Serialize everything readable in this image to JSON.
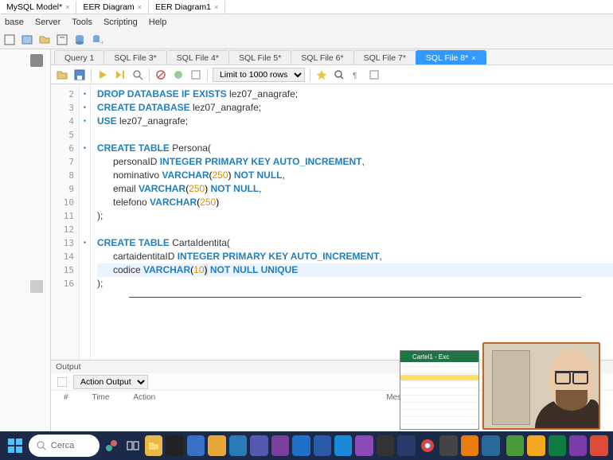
{
  "topTabs": [
    {
      "label": "MySQL Model*",
      "closable": true
    },
    {
      "label": "EER Diagram",
      "closable": true
    },
    {
      "label": "EER Diagram1",
      "closable": true
    }
  ],
  "menu": [
    "base",
    "Server",
    "Tools",
    "Scripting",
    "Help"
  ],
  "fileTabs": [
    {
      "label": "Query 1",
      "active": false
    },
    {
      "label": "SQL File 3*",
      "active": false
    },
    {
      "label": "SQL File 4*",
      "active": false
    },
    {
      "label": "SQL File 5*",
      "active": false
    },
    {
      "label": "SQL File 6*",
      "active": false
    },
    {
      "label": "SQL File 7*",
      "active": false
    },
    {
      "label": "SQL File 8*",
      "active": true
    }
  ],
  "rowsLimit": "Limit to 1000 rows",
  "code": {
    "l2": {
      "k": "DROP DATABASE IF EXISTS",
      "r": " lez07_anagrafe;"
    },
    "l3": {
      "k": "CREATE DATABASE",
      "r": " lez07_anagrafe;"
    },
    "l4": {
      "k": "USE",
      "r": " lez07_anagrafe;"
    },
    "l6": {
      "k": "CREATE TABLE",
      "r": " Persona("
    },
    "l7": {
      "pre": "      personaID ",
      "t": "INTEGER PRIMARY KEY AUTO_INCREMENT",
      "post": ","
    },
    "l8": {
      "pre": "      nominativo ",
      "t1": "VARCHAR",
      "p": "(",
      "n": "250",
      "cp": ")",
      "t2": " NOT NULL",
      "post": ","
    },
    "l9": {
      "pre": "      email ",
      "t1": "VARCHAR",
      "p": "(",
      "n": "250",
      "cp": ")",
      "t2": " NOT NULL",
      "post": ","
    },
    "l10": {
      "pre": "      telefono ",
      "t1": "VARCHAR",
      "p": "(",
      "n": "250",
      "cp": ")"
    },
    "l11": ");",
    "l13": {
      "k": "CREATE TABLE",
      "r": " CartaIdentita("
    },
    "l14": {
      "pre": "      cartaidentitaID ",
      "t": "INTEGER PRIMARY KEY AUTO_INCREMENT",
      "post": ","
    },
    "l15": {
      "pre": "      codice ",
      "t1": "VARCHAR",
      "p": "(",
      "n": "10",
      "cp": ")",
      "t2": " NOT NULL UNIQUE"
    },
    "l16": ");"
  },
  "gutter": [
    "2",
    "3",
    "4",
    "5",
    "6",
    "7",
    "8",
    "9",
    "10",
    "11",
    "12",
    "13",
    "14",
    "15",
    "16"
  ],
  "markers": {
    "2": "•",
    "3": "•",
    "4": "•",
    "6": "•",
    "13": "•"
  },
  "output": {
    "title": "Output",
    "ddLabel": "Action Output",
    "columns": [
      "#",
      "Time",
      "Action",
      "Message"
    ]
  },
  "search": {
    "placeholder": "Cerca"
  },
  "excelPip": {
    "title": "Cartel1 - Exc"
  }
}
